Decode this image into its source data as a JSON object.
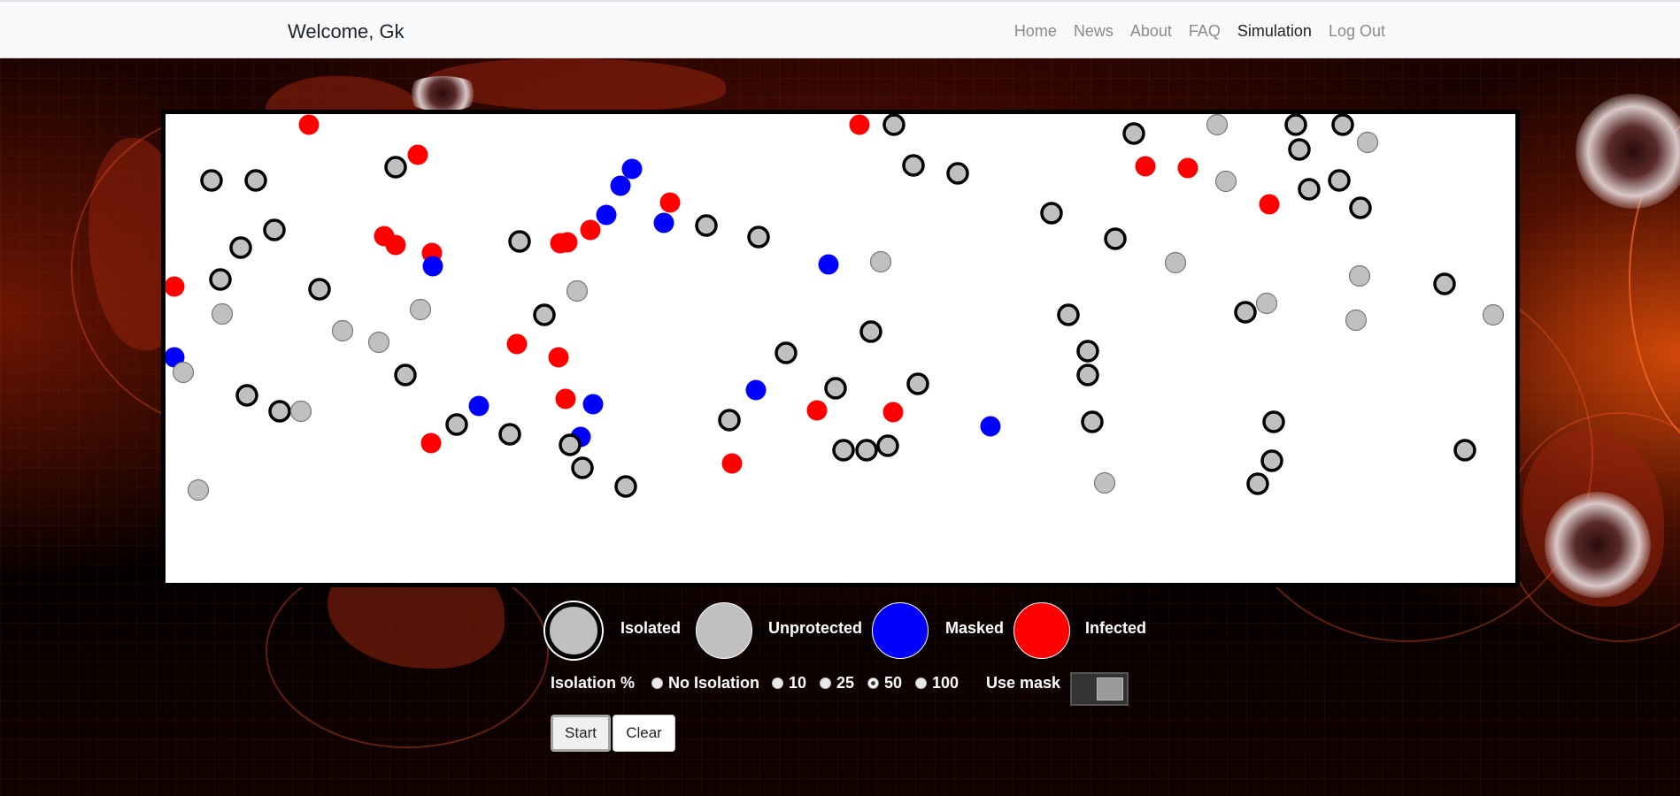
{
  "navbar": {
    "welcome": "Welcome, Gk",
    "links": [
      "Home",
      "News",
      "About",
      "FAQ",
      "Simulation",
      "Log Out"
    ],
    "active": "Simulation"
  },
  "legend": {
    "isolated": "Isolated",
    "unprotected": "Unprotected",
    "masked": "Masked",
    "infected": "Infected"
  },
  "controls": {
    "isolation_label": "Isolation %",
    "options": [
      "No Isolation",
      "10",
      "25",
      "50",
      "100"
    ],
    "selected": "50",
    "use_mask_label": "Use mask",
    "use_mask_on": true,
    "start_label": "Start",
    "clear_label": "Clear"
  },
  "colors": {
    "isolated_fill": "#c0c0c0",
    "unprotected_fill": "#c0c0c0",
    "masked_fill": "#0000ff",
    "infected_fill": "#ff0000"
  },
  "simulation": {
    "counts": {
      "isolated": 58,
      "unprotected": 20,
      "masked": 13,
      "infected": 24
    }
  }
}
